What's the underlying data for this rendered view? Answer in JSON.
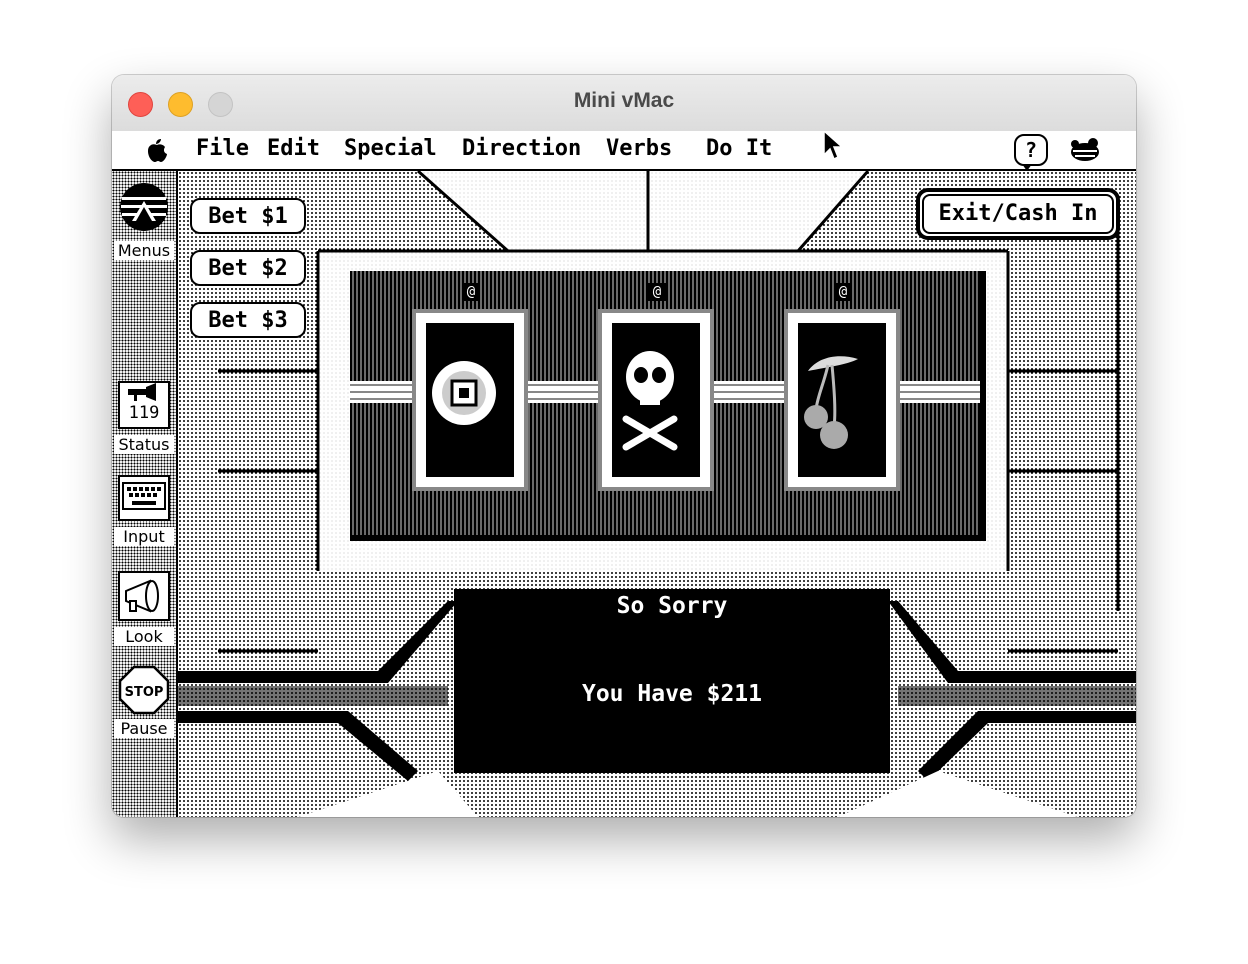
{
  "window": {
    "title": "Mini vMac"
  },
  "menubar": {
    "apple_icon": "apple-icon",
    "items": [
      "File",
      "Edit",
      "Special",
      "Direction",
      "Verbs",
      "Do It"
    ],
    "right_icons": [
      "help-balloon-icon",
      "application-menu-icon"
    ]
  },
  "sidebar": {
    "items": [
      {
        "label": "Menus",
        "icon": "globe-icon"
      },
      {
        "label": "Status",
        "icon": "status-icon",
        "value": "119"
      },
      {
        "label": "Input",
        "icon": "keyboard-icon"
      },
      {
        "label": "Look",
        "icon": "megaphone-icon"
      },
      {
        "label": "Pause",
        "icon": "stop-sign-icon",
        "icon_text": "STOP"
      }
    ]
  },
  "game": {
    "bet_buttons": [
      "Bet $1",
      "Bet $2",
      "Bet $3"
    ],
    "exit_button": "Exit/Cash In",
    "reels": [
      {
        "symbol": "bullseye-icon",
        "marker": "@"
      },
      {
        "symbol": "skull-crossbones-icon",
        "marker": "@"
      },
      {
        "symbol": "cherries-icon",
        "marker": "@"
      }
    ],
    "message": {
      "line1": "So Sorry",
      "line2": "You Have $211"
    }
  },
  "colors": {
    "foreground": "#000000",
    "background": "#ffffff",
    "close": "#fe5f57",
    "minimize": "#febc2e"
  }
}
